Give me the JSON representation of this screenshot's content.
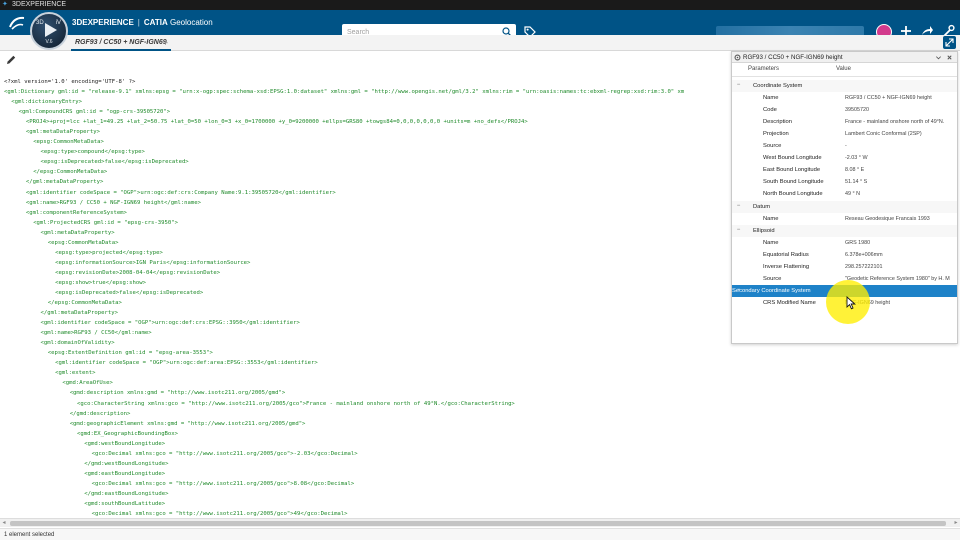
{
  "window": {
    "title": "3DEXPERIENCE"
  },
  "header": {
    "brand": "3DEXPERIENCE",
    "separator": "|",
    "product": "CATIA",
    "app": "Geolocation",
    "compass_version": "V.6",
    "compass_top": "3D",
    "compass_top2": "iV"
  },
  "search": {
    "placeholder": "Search"
  },
  "tabs": [
    {
      "label": "RGF93 / CC50 + NGF-IGN69"
    }
  ],
  "tab_add": "+",
  "colors": {
    "topbar": "#005386",
    "selection": "#1e82c8",
    "xml_tag": "#1f8a2a",
    "avatar": "#d23a8c"
  },
  "icons": {
    "toolbar": [
      "pencil-icon"
    ],
    "header": [
      "search-icon",
      "tag-icon",
      "plus-icon",
      "share-icon",
      "tools-icon"
    ],
    "panel": [
      "gear-icon",
      "chevron-down-icon",
      "close-icon"
    ]
  },
  "xml_lines": [
    {
      "indent": 0,
      "kind": "text",
      "text": "<?xml version='1.0' encoding='UTF-8' ?>"
    },
    {
      "indent": 0,
      "kind": "tag",
      "text": "<gml:Dictionary gml:id = \"release-9.1\" xmlns:epsg = \"urn:x-ogp:spec:schema-xsd:EPSG:1.0:dataset\" xmlns:gml = \"http://www.opengis.net/gml/3.2\" xmlns:rim = \"urn:oasis:names:tc:ebxml-regrep:xsd:rim:3.0\" xm"
    },
    {
      "indent": 1,
      "kind": "tag",
      "text": "<gml:dictionaryEntry>"
    },
    {
      "indent": 2,
      "kind": "tag",
      "text": "<gml:CompoundCRS gml:id = \"ogp-crs-39505720\">"
    },
    {
      "indent": 3,
      "kind": "tag",
      "text": "<PROJ4>+proj=lcc +lat_1=49.25 +lat_2=50.75 +lat_0=50 +lon_0=3 +x_0=1700000 +y_0=9200000 +ellps=GRS80 +towgs84=0,0,0,0,0,0,0 +units=m +no_defs</PROJ4>"
    },
    {
      "indent": 3,
      "kind": "tag",
      "text": "<gml:metaDataProperty>"
    },
    {
      "indent": 4,
      "kind": "tag",
      "text": "<epsg:CommonMetaData>"
    },
    {
      "indent": 5,
      "kind": "tag",
      "text": "<epsg:type>compound</epsg:type>"
    },
    {
      "indent": 5,
      "kind": "tag",
      "text": "<epsg:isDeprecated>false</epsg:isDeprecated>"
    },
    {
      "indent": 4,
      "kind": "tag",
      "text": "</epsg:CommonMetaData>"
    },
    {
      "indent": 3,
      "kind": "tag",
      "text": "</gml:metaDataProperty>"
    },
    {
      "indent": 3,
      "kind": "tag",
      "text": "<gml:identifier codeSpace = \"OGP\">urn:ogc:def:crs:Company Name:9.1:39505720</gml:identifier>"
    },
    {
      "indent": 3,
      "kind": "tag",
      "text": "<gml:name>RGF93 / CC50 + NGF-IGN69 height</gml:name>"
    },
    {
      "indent": 3,
      "kind": "tag",
      "text": "<gml:componentReferenceSystem>"
    },
    {
      "indent": 4,
      "kind": "tag",
      "text": "<gml:ProjectedCRS gml:id = \"epsg-crs-3950\">"
    },
    {
      "indent": 5,
      "kind": "tag",
      "text": "<gml:metaDataProperty>"
    },
    {
      "indent": 6,
      "kind": "tag",
      "text": "<epsg:CommonMetaData>"
    },
    {
      "indent": 7,
      "kind": "tag",
      "text": "<epsg:type>projected</epsg:type>"
    },
    {
      "indent": 7,
      "kind": "tag",
      "text": "<epsg:informationSource>IGN Paris</epsg:informationSource>"
    },
    {
      "indent": 7,
      "kind": "tag",
      "text": "<epsg:revisionDate>2008-04-04</epsg:revisionDate>"
    },
    {
      "indent": 7,
      "kind": "tag",
      "text": "<epsg:show>true</epsg:show>"
    },
    {
      "indent": 7,
      "kind": "tag",
      "text": "<epsg:isDeprecated>false</epsg:isDeprecated>"
    },
    {
      "indent": 6,
      "kind": "tag",
      "text": "</epsg:CommonMetaData>"
    },
    {
      "indent": 5,
      "kind": "tag",
      "text": "</gml:metaDataProperty>"
    },
    {
      "indent": 5,
      "kind": "tag",
      "text": "<gml:identifier codeSpace = \"OGP\">urn:ogc:def:crs:EPSG::3950</gml:identifier>"
    },
    {
      "indent": 5,
      "kind": "tag",
      "text": "<gml:name>RGF93 / CC50</gml:name>"
    },
    {
      "indent": 5,
      "kind": "tag",
      "text": "<gml:domainOfValidity>"
    },
    {
      "indent": 6,
      "kind": "tag",
      "text": "<epsg:ExtentDefinition gml:id = \"epsg-area-3553\">"
    },
    {
      "indent": 7,
      "kind": "tag",
      "text": "<gml:identifier codeSpace = \"OGP\">urn:ogc:def:area:EPSG::3553</gml:identifier>"
    },
    {
      "indent": 7,
      "kind": "tag",
      "text": "<gml:extent>"
    },
    {
      "indent": 8,
      "kind": "tag",
      "text": "<gmd:AreaOfUse>"
    },
    {
      "indent": 9,
      "kind": "tag",
      "text": "<gmd:description xmlns:gmd = \"http://www.isotc211.org/2005/gmd\">"
    },
    {
      "indent": 10,
      "kind": "tag",
      "text": "<gco:CharacterString xmlns:gco = \"http://www.isotc211.org/2005/gco\">France - mainland onshore north of 49°N.</gco:CharacterString>"
    },
    {
      "indent": 9,
      "kind": "tag",
      "text": "</gmd:description>"
    },
    {
      "indent": 9,
      "kind": "tag",
      "text": "<gmd:geographicElement xmlns:gmd = \"http://www.isotc211.org/2005/gmd\">"
    },
    {
      "indent": 10,
      "kind": "tag",
      "text": "<gmd:EX_GeographicBoundingBox>"
    },
    {
      "indent": 11,
      "kind": "tag",
      "text": "<gmd:westBoundLongitude>"
    },
    {
      "indent": 12,
      "kind": "tag",
      "text": "<gco:Decimal xmlns:gco = \"http://www.isotc211.org/2005/gco\">-2.03</gco:Decimal>"
    },
    {
      "indent": 11,
      "kind": "tag",
      "text": "</gmd:westBoundLongitude>"
    },
    {
      "indent": 11,
      "kind": "tag",
      "text": "<gmd:eastBoundLongitude>"
    },
    {
      "indent": 12,
      "kind": "tag",
      "text": "<gco:Decimal xmlns:gco = \"http://www.isotc211.org/2005/gco\">8.08</gco:Decimal>"
    },
    {
      "indent": 11,
      "kind": "tag",
      "text": "</gmd:eastBoundLongitude>"
    },
    {
      "indent": 11,
      "kind": "tag",
      "text": "<gmd:southBoundLatitude>"
    },
    {
      "indent": 12,
      "kind": "tag",
      "text": "<gco:Decimal xmlns:gco = \"http://www.isotc211.org/2005/gco\">49</gco:Decimal>"
    }
  ],
  "panel": {
    "title": "RGF93 / CC50 + NGF-IGN69 height",
    "col_params": "Parameters",
    "col_value": "Value",
    "rows": [
      {
        "type": "group",
        "exp": "−",
        "name": "Coordinate System",
        "value": ""
      },
      {
        "type": "child",
        "name": "Name",
        "value": "RGF93 / CC50 + NGF-IGN69 height"
      },
      {
        "type": "child",
        "name": "Code",
        "value": "39505720"
      },
      {
        "type": "child",
        "name": "Description",
        "value": "France - mainland onshore north of 49°N."
      },
      {
        "type": "child",
        "name": "Projection",
        "value": "Lambert Conic Conformal (2SP)"
      },
      {
        "type": "child",
        "name": "Source",
        "value": "-"
      },
      {
        "type": "child",
        "name": "West Bound Longitude",
        "value": "-2.03 ° W"
      },
      {
        "type": "child",
        "name": "East Bound Longitude",
        "value": "8.08 ° E"
      },
      {
        "type": "child",
        "name": "South Bound Longitude",
        "value": "51.14 ° S"
      },
      {
        "type": "child",
        "name": "North Bound Longitude",
        "value": "49 ° N"
      },
      {
        "type": "group",
        "exp": "−",
        "name": "Datum",
        "value": ""
      },
      {
        "type": "child",
        "name": "Name",
        "value": "Reseau Geodesique Francais 1993"
      },
      {
        "type": "group",
        "exp": "−",
        "name": "Ellipsoid",
        "value": ""
      },
      {
        "type": "child",
        "name": "Name",
        "value": "GRS 1980"
      },
      {
        "type": "child",
        "name": "Equatorial Radius",
        "value": "6.378e+006mm"
      },
      {
        "type": "child",
        "name": "Inverse Flattening",
        "value": "298.257222101"
      },
      {
        "type": "child",
        "name": "Source",
        "value": "\"Geodetic Reference System 1980\" by H. M"
      },
      {
        "type": "selected",
        "exp": "−",
        "name": "Secondary Coordinate System",
        "value": ""
      },
      {
        "type": "child",
        "name": "CRS Modified Name",
        "value": "NGF-IGN69 height"
      }
    ]
  },
  "status": {
    "text": "1 element selected"
  }
}
